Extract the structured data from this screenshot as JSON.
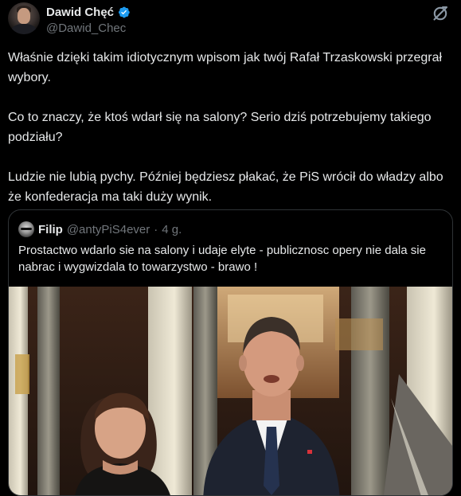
{
  "author": {
    "name": "Dawid Chęć",
    "handle": "@Dawid_Chec",
    "verified": true,
    "verified_color": "#1d9bf0"
  },
  "grok_icon": "grok-icon",
  "tweet": {
    "text": "Właśnie dzięki takim idiotycznym wpisom jak twój Rafał Trzaskowski przegrał wybory.\n\nCo to znaczy, że ktoś wdarł się na salony? Serio dziś potrzebujemy takiego podziału?\n\nLudzie nie lubią pychy. Później będziesz płakać, że PiS wrócił do władzy albo że konfederacja ma taki duży wynik."
  },
  "quote": {
    "name": "Filip",
    "handle": "@antyPiS4ever",
    "separator": "·",
    "time": "4 g.",
    "text": "Prostactwo wdarlo sie na salony i udaje elyte - publicznosc opery nie dala sie nabrac i wygwizdala to towarzystwo - brawo !",
    "media_description": "photo"
  },
  "colors": {
    "background": "#000000",
    "text": "#e7e9ea",
    "secondary": "#71767b",
    "border": "#2f3336"
  }
}
